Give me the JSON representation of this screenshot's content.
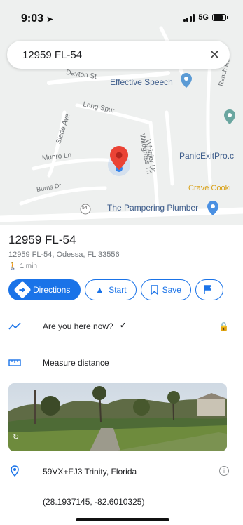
{
  "status_bar": {
    "time": "9:03",
    "network": "5G"
  },
  "search": {
    "query": "12959 FL-54"
  },
  "map": {
    "street_labels": [
      "Dayton St",
      "Long Spur",
      "Slade Ave",
      "Munro Ln",
      "Burns Dr",
      "Whittier Dr",
      "Wildgrass Trl",
      "Ranch Rd"
    ],
    "route_shield": "54",
    "pois": [
      "Effective Speech",
      "PanicExitPro.c",
      "Crave Cooki",
      "The Pampering Plumber"
    ]
  },
  "place": {
    "title": "12959 FL-54",
    "address": "12959 FL-54, Odessa, FL 33556",
    "walk_time": "1 min"
  },
  "actions": {
    "directions": "Directions",
    "start": "Start",
    "save": "Save"
  },
  "rows": {
    "here_now": "Are you here now?",
    "measure": "Measure distance",
    "plus_code": "59VX+FJ3 Trinity, Florida",
    "coordinates": "(28.1937145, -82.6010325)"
  },
  "colors": {
    "accent": "#1a73e8",
    "pin": "#ea4335",
    "map_background": "#eef0ef"
  },
  "icons": [
    "location-arrow-icon",
    "signal-icon",
    "battery-icon",
    "close-icon",
    "map-pin-icon",
    "walk-icon",
    "directions-icon",
    "navigation-arrow-icon",
    "bookmark-icon",
    "flag-icon",
    "trend-icon",
    "lock-icon",
    "ruler-icon",
    "rotate-360-icon",
    "location-pin-icon",
    "info-icon"
  ]
}
